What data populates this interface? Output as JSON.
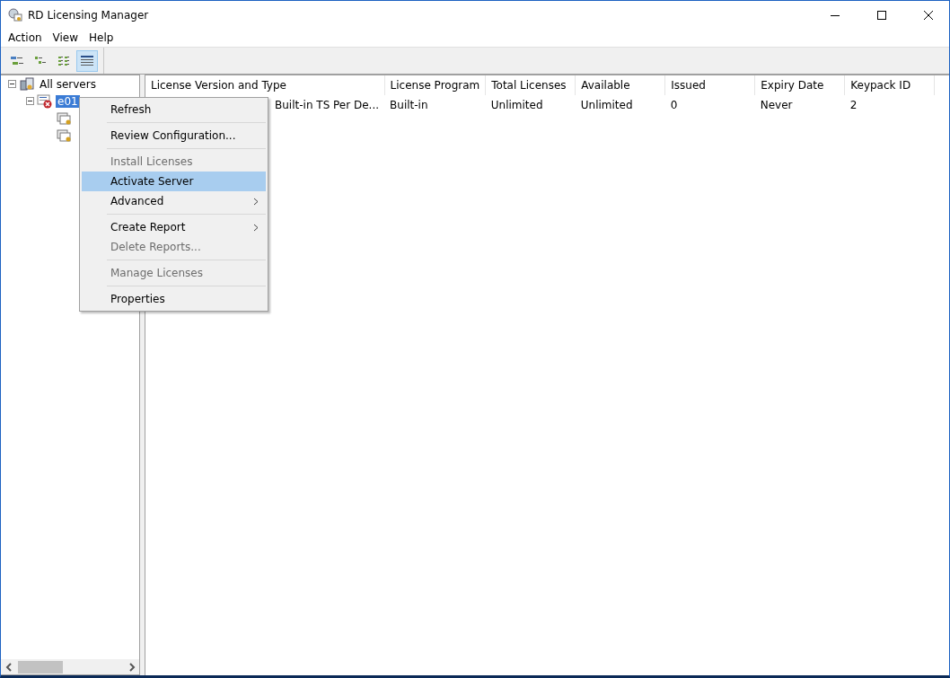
{
  "window": {
    "title": "RD Licensing Manager"
  },
  "menu_bar": [
    "Action",
    "View",
    "Help"
  ],
  "toolbar": [
    {
      "selected": false
    },
    {
      "selected": false
    },
    {
      "selected": false
    },
    {
      "selected": true
    }
  ],
  "tree": [
    {
      "label": "All servers",
      "expanded": true,
      "kind": "group",
      "selected": false,
      "children": [
        {
          "label": "e01",
          "expanded": true,
          "kind": "server",
          "selected": true,
          "children": [
            {
              "kind": "licenses"
            },
            {
              "kind": "licenses"
            }
          ]
        }
      ]
    }
  ],
  "table": {
    "columns": [
      "License Version and Type",
      "License Program",
      "Total Licenses",
      "Available",
      "Issued",
      "Expiry Date",
      "Keypack ID"
    ],
    "rows": [
      [
        "Built-in TS Per De...",
        "Built-in",
        "Unlimited",
        "Unlimited",
        "0",
        "Never",
        "2"
      ]
    ]
  },
  "context_menu": [
    {
      "kind": "item",
      "label": "Refresh",
      "disabled": false,
      "selected": false,
      "submenu": false
    },
    {
      "kind": "separator"
    },
    {
      "kind": "item",
      "label": "Review Configuration...",
      "disabled": false,
      "selected": false,
      "submenu": false
    },
    {
      "kind": "separator"
    },
    {
      "kind": "item",
      "label": "Install Licenses",
      "disabled": true,
      "selected": false,
      "submenu": false
    },
    {
      "kind": "item",
      "label": "Activate Server",
      "disabled": false,
      "selected": true,
      "submenu": false
    },
    {
      "kind": "item",
      "label": "Advanced",
      "disabled": false,
      "selected": false,
      "submenu": true
    },
    {
      "kind": "separator"
    },
    {
      "kind": "item",
      "label": "Create Report",
      "disabled": false,
      "selected": false,
      "submenu": true
    },
    {
      "kind": "item",
      "label": "Delete Reports...",
      "disabled": true,
      "selected": false,
      "submenu": false
    },
    {
      "kind": "separator"
    },
    {
      "kind": "item",
      "label": "Manage Licenses",
      "disabled": true,
      "selected": false,
      "submenu": false
    },
    {
      "kind": "separator"
    },
    {
      "kind": "item",
      "label": "Properties",
      "disabled": false,
      "selected": false,
      "submenu": false
    }
  ]
}
